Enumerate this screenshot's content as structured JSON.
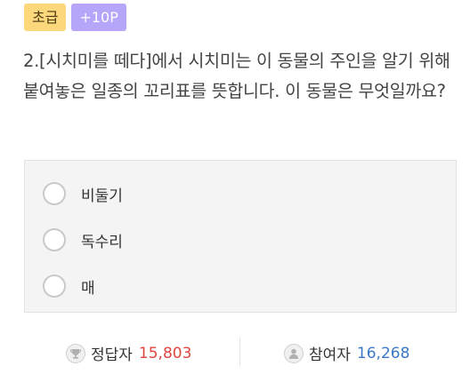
{
  "badges": {
    "level": "초급",
    "points": "+10P"
  },
  "question": {
    "text": "2.[시치미를 떼다]에서 시치미는 이 동물의 주인을 알기 위해 붙여놓은 일종의 꼬리표를 뜻합니다. 이 동물은 무엇일까요?"
  },
  "options": [
    {
      "label": "비둘기"
    },
    {
      "label": "독수리"
    },
    {
      "label": "매"
    }
  ],
  "stats": {
    "correct_label": "정답자",
    "correct_count": "15,803",
    "participants_label": "참여자",
    "participants_count": "16,268"
  },
  "colors": {
    "level_badge": "#fdd77c",
    "points_badge": "#b6a5f8",
    "correct_count": "#e0473f",
    "participants_count": "#3b78c7"
  },
  "icons": {
    "correct": "trophy-icon",
    "participants": "person-icon"
  }
}
